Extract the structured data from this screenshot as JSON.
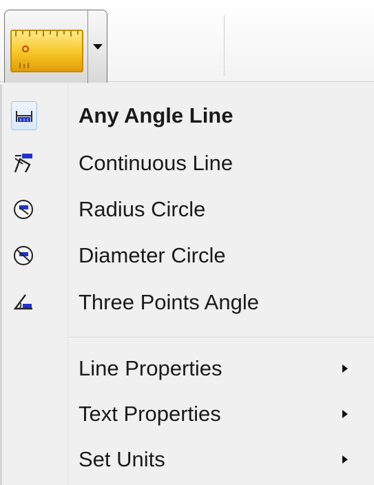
{
  "toolbar": {
    "tool_button_icon": "ruler-icon",
    "dropdown_icon": "dropdown-arrow-icon"
  },
  "menu": {
    "items": [
      {
        "label": "Any Angle Line",
        "icon": "any-angle-line-icon",
        "selected": true
      },
      {
        "label": "Continuous Line",
        "icon": "continuous-line-icon"
      },
      {
        "label": "Radius Circle",
        "icon": "radius-circle-icon"
      },
      {
        "label": "Diameter Circle",
        "icon": "diameter-circle-icon"
      },
      {
        "label": "Three Points Angle",
        "icon": "three-points-angle-icon"
      }
    ],
    "submenus": [
      {
        "label": "Line Properties",
        "icon": "submenu-arrow-icon"
      },
      {
        "label": "Text Properties",
        "icon": "submenu-arrow-icon"
      },
      {
        "label": "Set Units",
        "icon": "submenu-arrow-icon"
      }
    ]
  },
  "colors": {
    "ruler_fill": "#f7c625",
    "ruler_border": "#c58a00",
    "icon_blue": "#2233cc",
    "icon_dark": "#222222",
    "selection_border": "#9ec3e8",
    "menu_background": "#f0f0f0"
  }
}
